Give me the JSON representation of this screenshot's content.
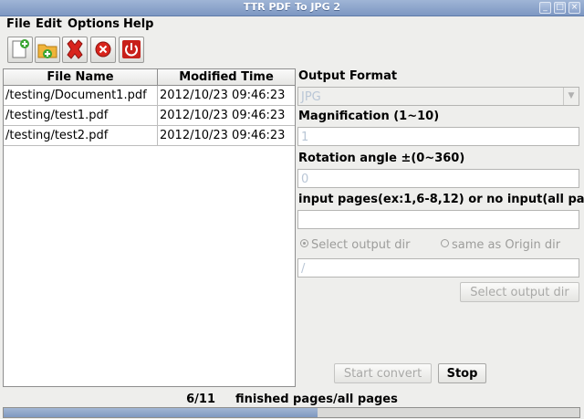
{
  "window": {
    "title": "TTR PDF To JPG 2",
    "controls": [
      "_",
      "□",
      "×"
    ]
  },
  "menu": {
    "items": [
      "File",
      "Edit",
      "Options",
      "Help"
    ]
  },
  "toolbar": {
    "buttons": [
      {
        "name": "add-file",
        "icon": "new-document-plus-icon",
        "color": "#3aa533"
      },
      {
        "name": "add-folder",
        "icon": "folder-plus-icon",
        "color": "#e0a21c"
      },
      {
        "name": "remove",
        "icon": "red-x-icon",
        "color": "#d8241c"
      },
      {
        "name": "stop",
        "icon": "circle-x-icon",
        "color": "#d8241c"
      },
      {
        "name": "exit",
        "icon": "power-icon",
        "color": "#c8201a"
      }
    ]
  },
  "file_table": {
    "columns": [
      "File Name",
      "Modified Time"
    ],
    "rows": [
      {
        "name": "/testing/Document1.pdf",
        "time": "2012/10/23 09:46:23"
      },
      {
        "name": "/testing/test1.pdf",
        "time": "2012/10/23 09:46:23"
      },
      {
        "name": "/testing/test2.pdf",
        "time": "2012/10/23 09:46:23"
      }
    ]
  },
  "options": {
    "output_format_label": "Output Format",
    "output_format_value": "JPG",
    "magnification_label": "Magnification (1~10)",
    "magnification_value": "1",
    "rotation_label": "Rotation angle ±(0~360)",
    "rotation_value": "0",
    "pages_label": "input pages(ex:1,6-8,12) or no input(all pages)",
    "pages_value": "",
    "radio_select_dir": "Select output dir",
    "radio_same_dir": "same as Origin dir",
    "output_dir_value": "/",
    "select_dir_button": "Select output dir"
  },
  "actions": {
    "start_label": "Start convert",
    "stop_label": "Stop"
  },
  "status": {
    "count": "6/11",
    "text": "finished pages/all pages",
    "progress_fraction": 0.545
  }
}
